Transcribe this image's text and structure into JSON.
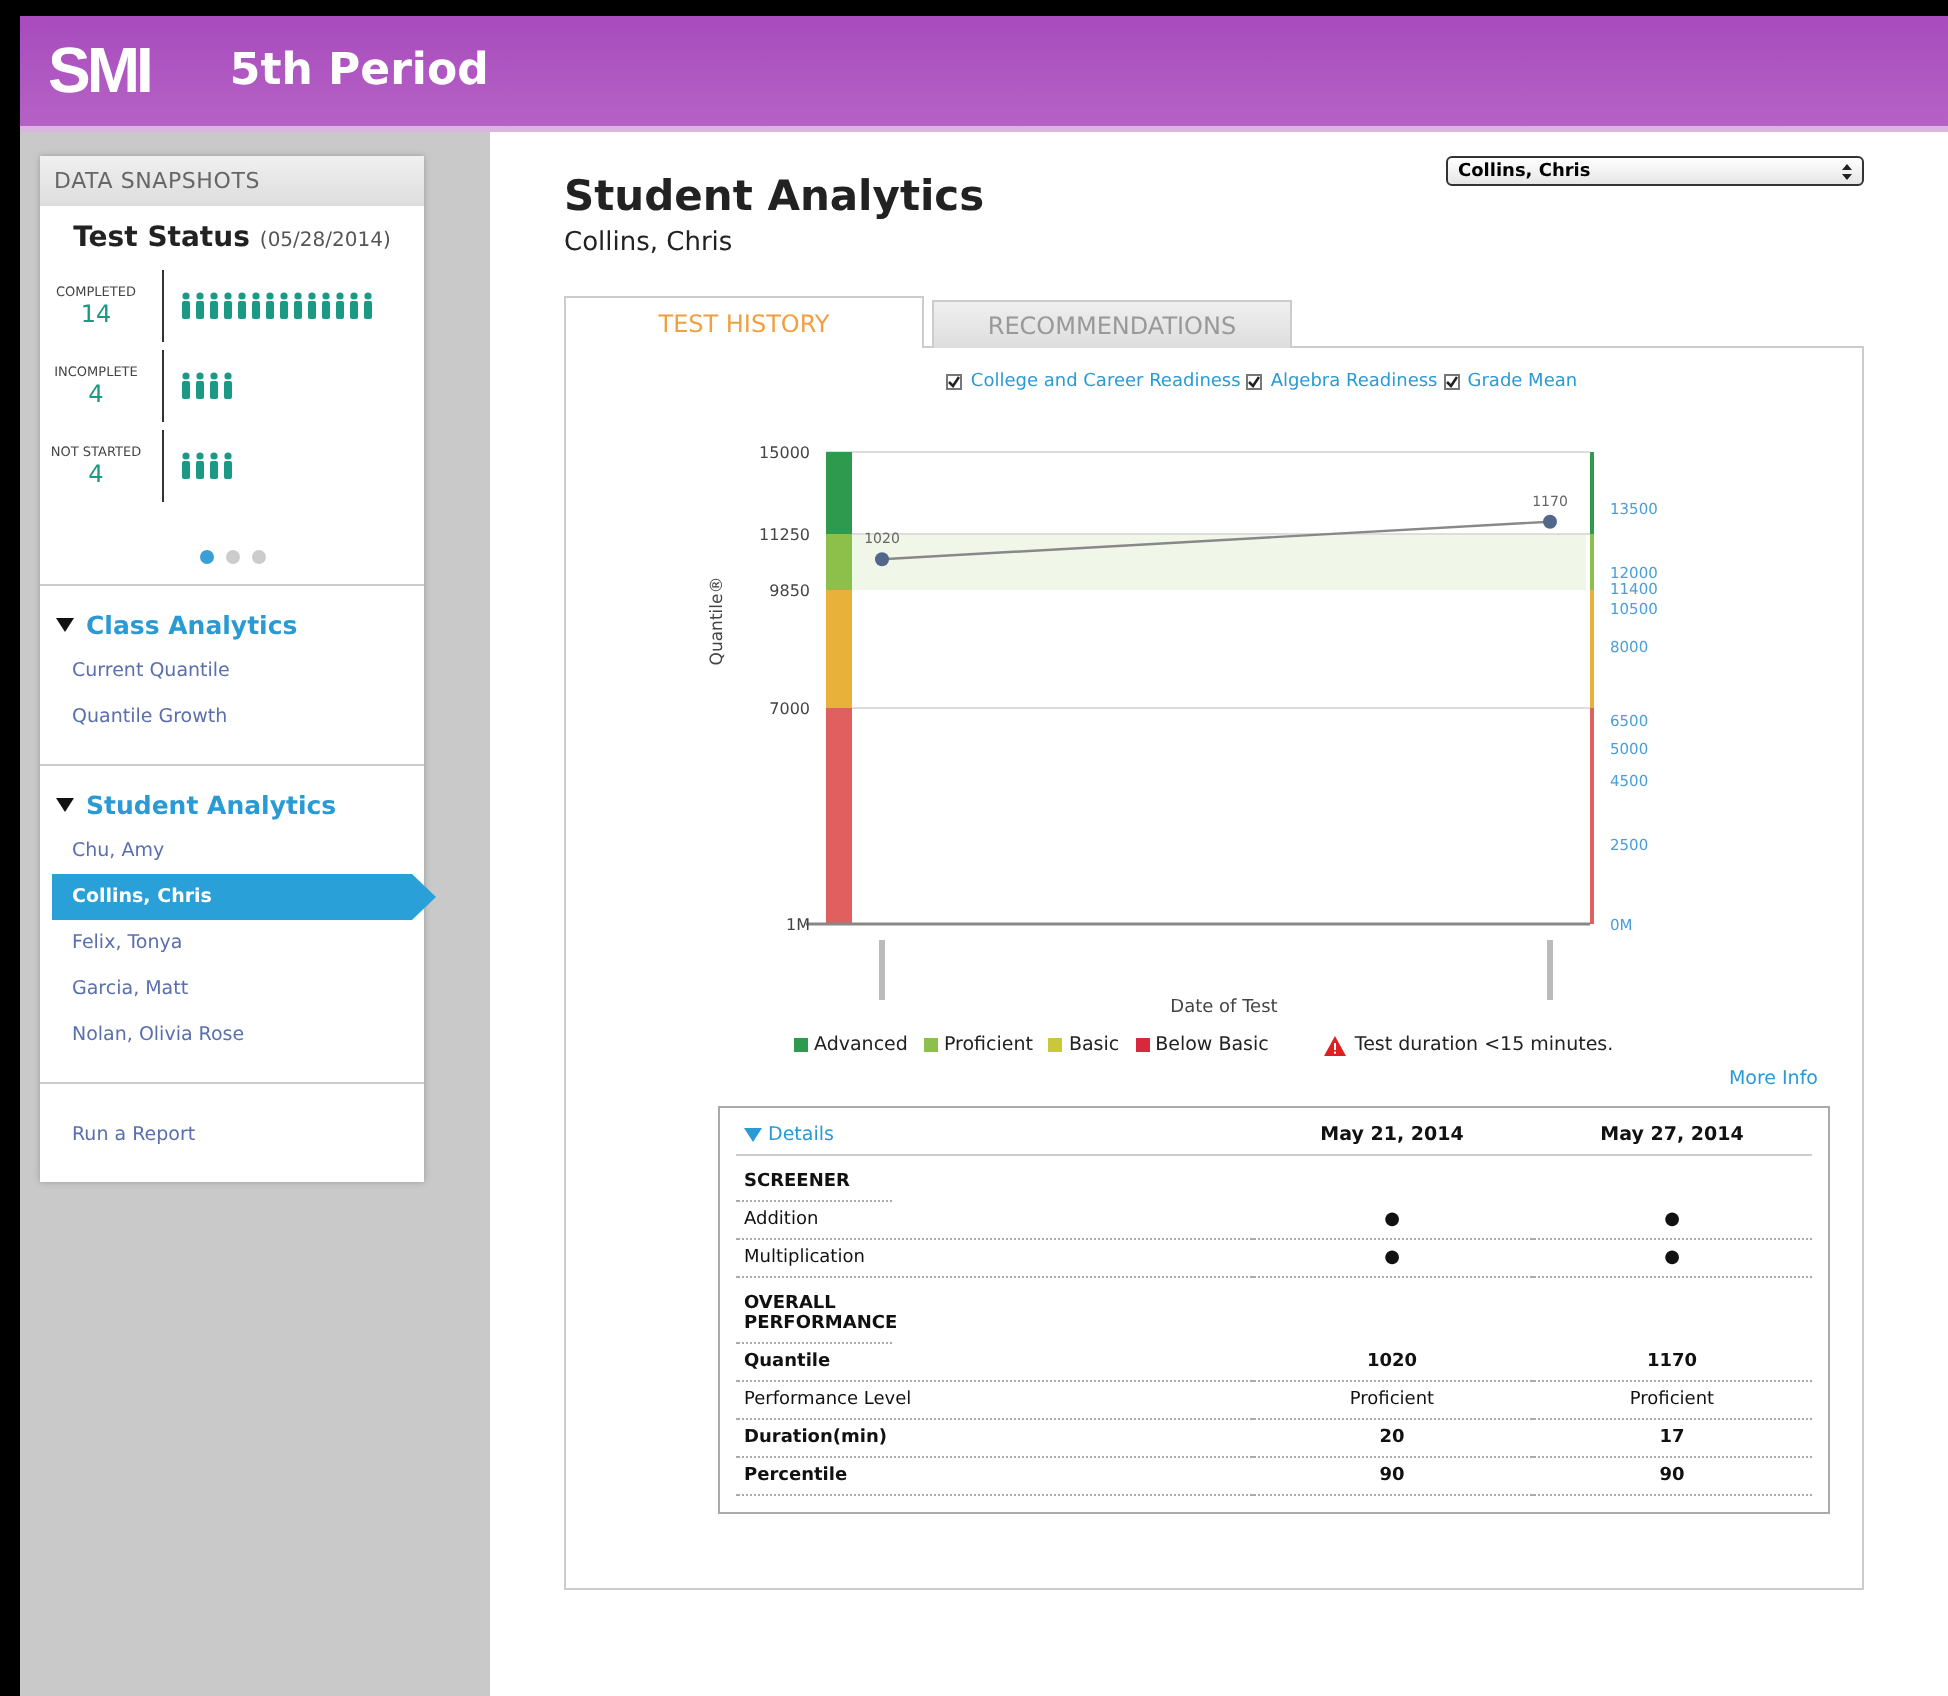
{
  "header": {
    "logo": "SMI",
    "title": "5th Period"
  },
  "sidebar": {
    "snapshot_heading": "DATA SNAPSHOTS",
    "status_title": "Test Status",
    "status_date": "(05/28/2014)",
    "statuses": [
      {
        "label": "COMPLETED",
        "count": "14"
      },
      {
        "label": "INCOMPLETE",
        "count": "4"
      },
      {
        "label": "NOT STARTED",
        "count": "4"
      }
    ],
    "pager": [
      {
        "selected": true
      },
      {
        "selected": false
      },
      {
        "selected": false
      }
    ],
    "sections": [
      {
        "title": "Class Analytics",
        "expanded": true,
        "items": [
          {
            "label": "Current Quantile",
            "selected": false
          },
          {
            "label": "Quantile Growth",
            "selected": false
          }
        ]
      },
      {
        "title": "Student Analytics",
        "expanded": true,
        "items": [
          {
            "label": "Chu, Amy",
            "selected": false
          },
          {
            "label": "Collins, Chris",
            "selected": true
          },
          {
            "label": "Felix, Tonya",
            "selected": false
          },
          {
            "label": "Garcia, Matt",
            "selected": false
          },
          {
            "label": "Nolan, Olivia Rose",
            "selected": false
          }
        ]
      }
    ],
    "footer_link": "Run a Report"
  },
  "main": {
    "title": "Student Analytics",
    "student": "Collins, Chris",
    "student_select": {
      "value": "Collins, Chris"
    },
    "tabs": [
      {
        "label": "TEST HISTORY",
        "selected": true
      },
      {
        "label": "RECOMMENDATIONS",
        "selected": false
      }
    ],
    "filters": [
      {
        "label": "College and Career Readiness",
        "checked": true
      },
      {
        "label": "Algebra Readiness",
        "checked": true
      },
      {
        "label": "Grade Mean",
        "checked": true
      }
    ],
    "chart": {
      "xlabel": "Date of Test",
      "ylabel": "Quantile®",
      "point_labels": [
        "1020",
        "1170"
      ],
      "left_axis_labels": [
        "15000",
        "11250",
        "9850",
        "7000",
        "1M"
      ]
    },
    "right_axis_labels": [
      "13500",
      "12000",
      "11400",
      "10500",
      "8000",
      "6500",
      "5000",
      "4500",
      "2500",
      "0M"
    ],
    "levels": [
      {
        "label": "Advanced",
        "color": "#2e9a4e"
      },
      {
        "label": "Proficient",
        "color": "#8cc04b"
      },
      {
        "label": "Basic",
        "color": "#c8c83a"
      },
      {
        "label": "Below Basic",
        "color": "#d8283c"
      }
    ],
    "warning": "Test duration <15 minutes.",
    "more_info": "More Info",
    "details": {
      "toggle": "Details",
      "expanded": true,
      "dates": [
        "May 21, 2014",
        "May 27, 2014"
      ],
      "sections": [
        {
          "title": "SCREENER",
          "rows": [
            {
              "label": "Addition",
              "values": [
                "●",
                "●"
              ],
              "bold": false
            },
            {
              "label": "Multiplication",
              "values": [
                "●",
                "●"
              ],
              "bold": false
            }
          ]
        },
        {
          "title": "OVERALL PERFORMANCE",
          "rows": [
            {
              "label": "Quantile",
              "values": [
                "1020",
                "1170"
              ],
              "bold": true
            },
            {
              "label": "Performance Level",
              "values": [
                "Proficient",
                "Proficient"
              ],
              "bold": false
            },
            {
              "label": "Duration(min)",
              "values": [
                "20",
                "17"
              ],
              "bold": true
            },
            {
              "label": "Percentile",
              "values": [
                "90",
                "90"
              ],
              "bold": true
            }
          ]
        }
      ]
    }
  }
}
